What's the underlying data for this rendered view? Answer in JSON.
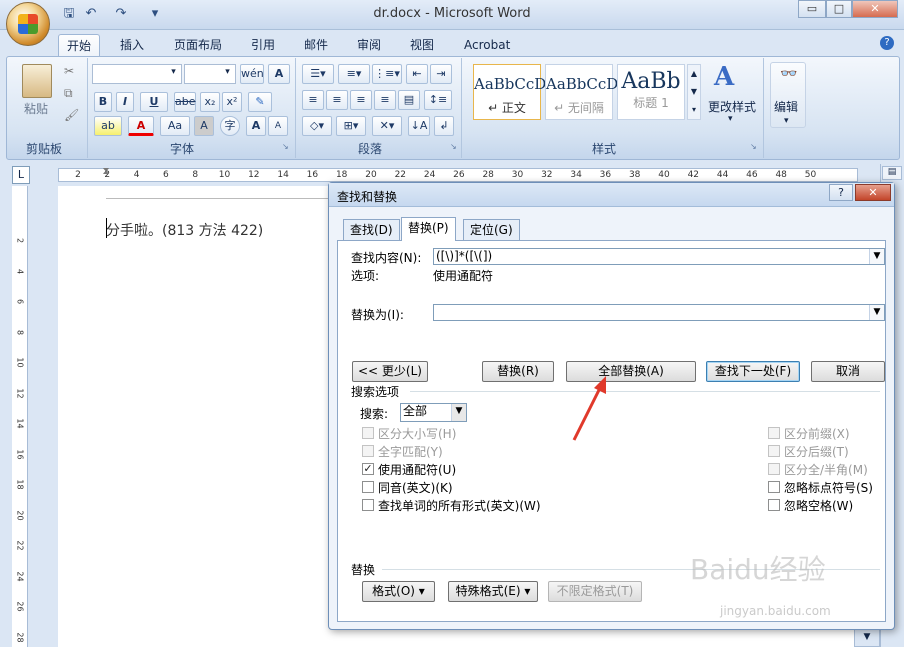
{
  "window": {
    "title": "dr.docx - Microsoft Word",
    "controls": [
      "▭",
      "□",
      "✕"
    ]
  },
  "qat": {
    "save_icon": "save-icon",
    "undo_icon": "undo-icon",
    "redo_icon": "redo-icon",
    "more": "▾"
  },
  "tabs": [
    "开始",
    "插入",
    "页面布局",
    "引用",
    "邮件",
    "审阅",
    "视图",
    "Acrobat"
  ],
  "active_tab": "开始",
  "help_icon": "?",
  "ribbon": {
    "clipboard": {
      "paste_label": "粘贴",
      "group_label": "剪贴板"
    },
    "font": {
      "group_label": "字体",
      "bold": "B",
      "italic": "I",
      "underline": "U",
      "strike": "abe",
      "sub": "x₂",
      "sup": "x²",
      "grow": "A",
      "shrink": "A",
      "clear": "Aa",
      "highlight": "ab",
      "color": "A"
    },
    "paragraph": {
      "group_label": "段落"
    },
    "styles": {
      "group_label": "样式",
      "items": [
        {
          "sample": "AaBbCcD",
          "name": "↵ 正文"
        },
        {
          "sample": "AaBbCcD",
          "name": "↵ 无间隔"
        },
        {
          "sample": "AaBb",
          "name": "标题 1"
        }
      ],
      "change_styles": "更改样式"
    },
    "editing": {
      "label": "编辑"
    }
  },
  "ruler": {
    "ticks": [
      "2",
      "2",
      "4",
      "6",
      "8",
      "10",
      "12",
      "14",
      "16",
      "18",
      "20",
      "22",
      "24",
      "26",
      "28",
      "30",
      "32",
      "34",
      "36",
      "38",
      "40",
      "42",
      "44",
      "46",
      "48",
      "50"
    ],
    "vticks": [
      "2",
      "4",
      "6",
      "8",
      "10",
      "12",
      "14",
      "16",
      "18",
      "20",
      "22",
      "24",
      "26",
      "28"
    ]
  },
  "document": {
    "text": "分手啦。(813 方法 422)"
  },
  "dialog": {
    "title": "查找和替换",
    "help": "?",
    "close": "✕",
    "tabs": [
      "查找(D)",
      "替换(P)",
      "定位(G)"
    ],
    "active_tab": "替换(P)",
    "find_label": "查找内容(N):",
    "find_value": "([\\)]*([\\(])",
    "options_label": "选项:",
    "options_value": "使用通配符",
    "replace_label": "替换为(I):",
    "replace_value": "",
    "buttons": {
      "less": "<< 更少(L)",
      "replace": "替换(R)",
      "replace_all": "全部替换(A)",
      "find_next": "查找下一处(F)",
      "cancel": "取消"
    },
    "search_options_title": "搜索选项",
    "search_label": "搜索:",
    "search_value": "全部",
    "left_options": [
      {
        "label": "区分大小写(H)",
        "checked": false,
        "disabled": true
      },
      {
        "label": "全字匹配(Y)",
        "checked": false,
        "disabled": true
      },
      {
        "label": "使用通配符(U)",
        "checked": true,
        "disabled": false
      },
      {
        "label": "同音(英文)(K)",
        "checked": false,
        "disabled": false
      },
      {
        "label": "查找单词的所有形式(英文)(W)",
        "checked": false,
        "disabled": false
      }
    ],
    "right_options": [
      {
        "label": "区分前缀(X)",
        "checked": false,
        "disabled": true
      },
      {
        "label": "区分后缀(T)",
        "checked": false,
        "disabled": true
      },
      {
        "label": "区分全/半角(M)",
        "checked": false,
        "disabled": true
      },
      {
        "label": "忽略标点符号(S)",
        "checked": false,
        "disabled": false
      },
      {
        "label": "忽略空格(W)",
        "checked": false,
        "disabled": false
      }
    ],
    "replace_section_title": "替换",
    "bottom_buttons": {
      "format": "格式(O) ▾",
      "special": "特殊格式(E) ▾",
      "no_format": "不限定格式(T)"
    }
  },
  "watermark": {
    "text": "Baidu经验",
    "sub": "jingyan.baidu.com"
  },
  "colors": {
    "accent": "#dbe6f4",
    "arrow": "#e0392b"
  }
}
